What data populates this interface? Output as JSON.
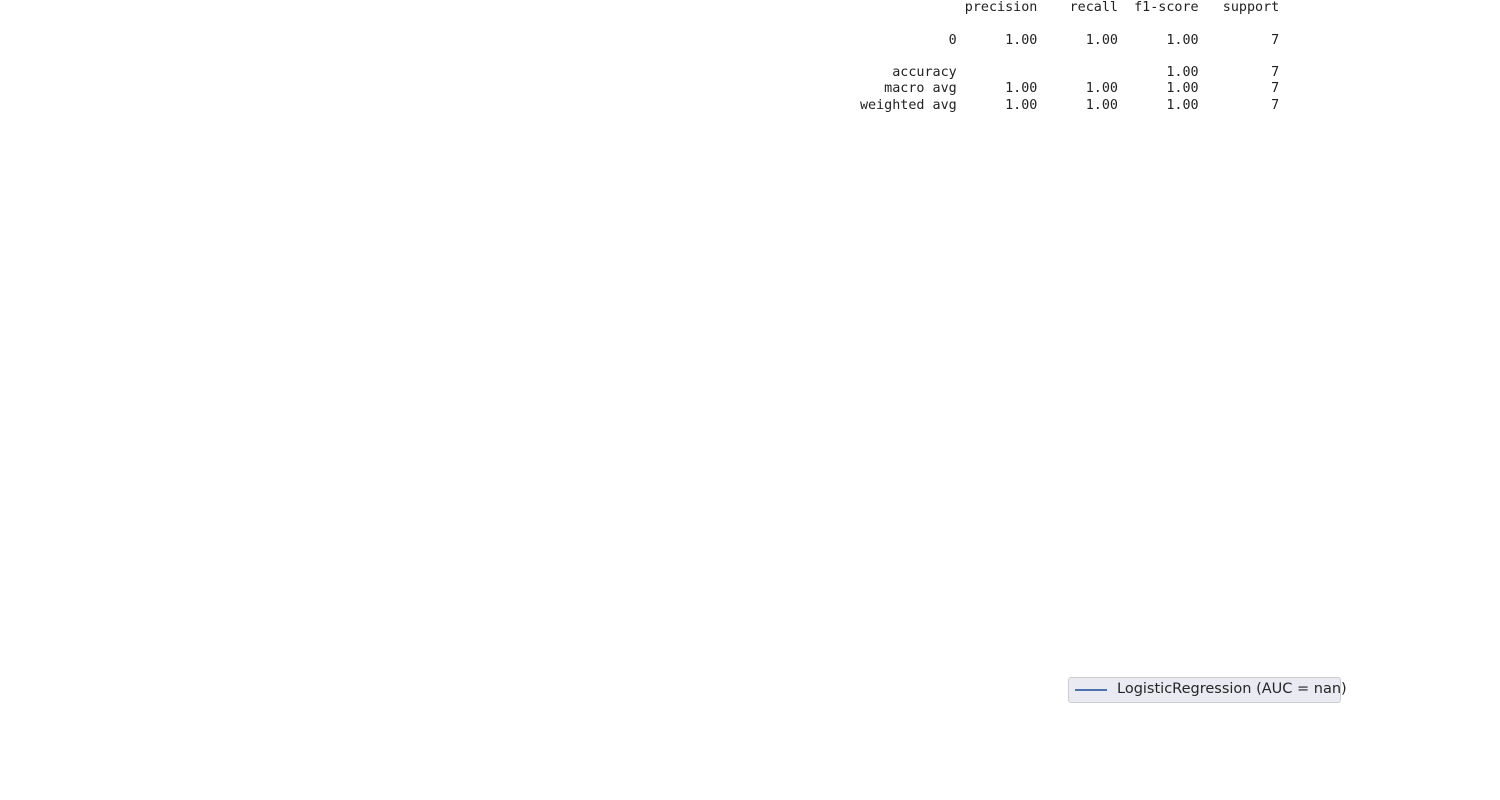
{
  "classification_report": {
    "columns": [
      "precision",
      "recall",
      "f1-score",
      "support"
    ],
    "rows": [
      {
        "label": "0",
        "precision": "1.00",
        "recall": "1.00",
        "f1-score": "1.00",
        "support": "7"
      },
      {
        "label": "accuracy",
        "precision": "",
        "recall": "",
        "f1-score": "1.00",
        "support": "7"
      },
      {
        "label": "macro avg",
        "precision": "1.00",
        "recall": "1.00",
        "f1-score": "1.00",
        "support": "7"
      },
      {
        "label": "weighted avg",
        "precision": "1.00",
        "recall": "1.00",
        "f1-score": "1.00",
        "support": "7"
      }
    ]
  },
  "chart_data": {
    "type": "line",
    "series": [
      {
        "name": "LogisticRegression (AUC = nan)",
        "values": []
      }
    ],
    "legend_position": "bottom-right",
    "colors": {
      "series_line": "#4c72b0",
      "legend_bg": "#eaeaf2"
    }
  }
}
